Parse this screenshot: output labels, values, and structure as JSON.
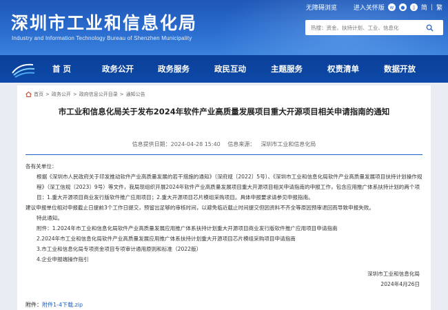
{
  "header": {
    "title": "深圳市工业和信息化局",
    "subtitle": "Industry and Information Technology Bureau of Shenzhen Municipality",
    "top_links": {
      "accessible": "无障碍浏览",
      "care": "进入关怀版",
      "simplified": "简",
      "traditional": "繁"
    },
    "search_placeholder": "热搜：资金、扶持计划、工业、信息化"
  },
  "nav": {
    "items": [
      "首 页",
      "政务公开",
      "政务服务",
      "政民互动",
      "主题服务",
      "权责清单",
      "数据开放"
    ]
  },
  "breadcrumb": [
    "首页",
    "政务公开",
    "政府信息公开目录",
    "通知公告"
  ],
  "article": {
    "title": "市工业和信息化局关于发布2024年软件产业高质量发展项目重大开源项目相关申请指南的通知",
    "meta": {
      "date_label": "信息提供日期：2024-04-28 15:40",
      "source_label": "信息来源：",
      "source_value": "深圳市工业和信息化局"
    },
    "salutation": "各有关单位：",
    "paragraphs": [
      "根据《深圳市人民政府关于印发推动软件产业高质量发展的若干措施的通知》（深府规〔2022〕5号）、《深圳市工业和信息化局软件产业高质量发展项目扶持计划操作规程》（深工信规〔2023〕9号）等文件，我局现组织开展2024年软件产业高质量发展项目重大开源项目相关申请指南的申报工作，包含应用推广体系扶持计划的两个项目：1.重大开源项目商业发行版软件推广应用项目；2.重大开源项目芯片模组采购项目。具体申报要求请参见申报指南。",
      "建议申报单位相对申报截止日提前3个工作日提交，预留出足够的审核时间，以避免临近截止时间提交但因资料不齐全等原因预审退回而导致申报失败。",
      "特此通知。",
      "附件：1.2024年市工业和信息化局软件产业高质量发展应用推广体系扶持计划重大开源项目商业发行版软件推广应用项目申请指南",
      "2.2024年市工业和信息化局软件产业高质量发展应用推广体系扶持计划重大开源项目芯片模组采购项目申请指南",
      "3.市工业和信息化局专项资金项目专项审计通用原则和标准（2022版）",
      "4.企业申报端操作指引"
    ],
    "signature": "深圳市工业和信息化局",
    "sign_date": "2024年4月26日",
    "attachment_label": "附件：",
    "attachment_link": "附件1-4下载.zip"
  },
  "colors": {
    "header": "#2b6ed0",
    "nav": "#0d4aa8",
    "link": "#1b5fc1"
  }
}
